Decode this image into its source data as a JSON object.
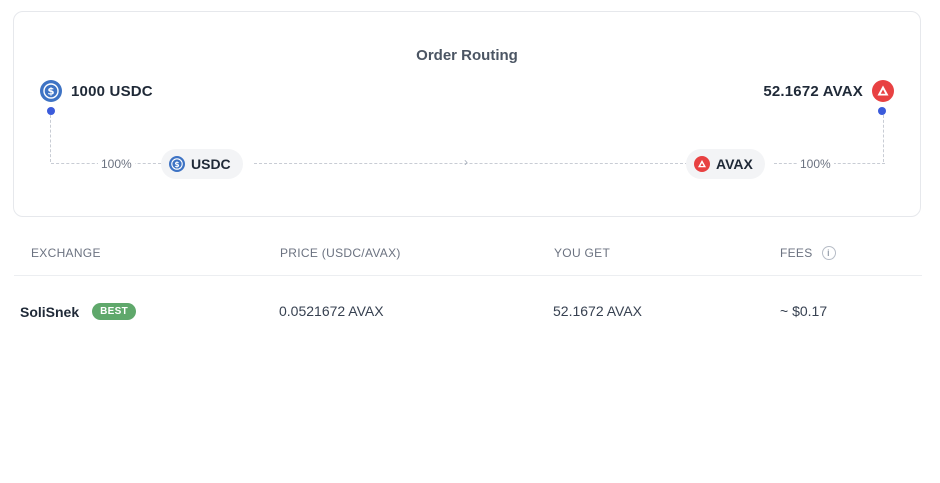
{
  "routing": {
    "title": "Order Routing",
    "from": {
      "amount": "1000",
      "symbol": "USDC",
      "label": "1000 USDC",
      "icon": "usdc-icon"
    },
    "to": {
      "amount": "52.1672",
      "symbol": "AVAX",
      "label": "52.1672 AVAX",
      "icon": "avax-icon"
    },
    "route": {
      "left_percent": "100%",
      "right_percent": "100%",
      "hops": [
        {
          "symbol": "USDC",
          "icon": "usdc-icon"
        },
        {
          "symbol": "AVAX",
          "icon": "avax-icon"
        }
      ],
      "separator": "›"
    }
  },
  "table": {
    "headers": {
      "exchange": "EXCHANGE",
      "price": "PRICE (USDC/AVAX)",
      "you_get": "YOU GET",
      "fees": "FEES"
    },
    "rows": [
      {
        "exchange": "SoliSnek",
        "badge": "BEST",
        "price": "0.0521672 AVAX",
        "you_get": "52.1672 AVAX",
        "fees": "~ $0.17"
      }
    ]
  },
  "colors": {
    "usdc": "#3e73c4",
    "avax": "#e84142",
    "route_dot": "#3b5bdb",
    "best_badge": "#5fa86b"
  }
}
